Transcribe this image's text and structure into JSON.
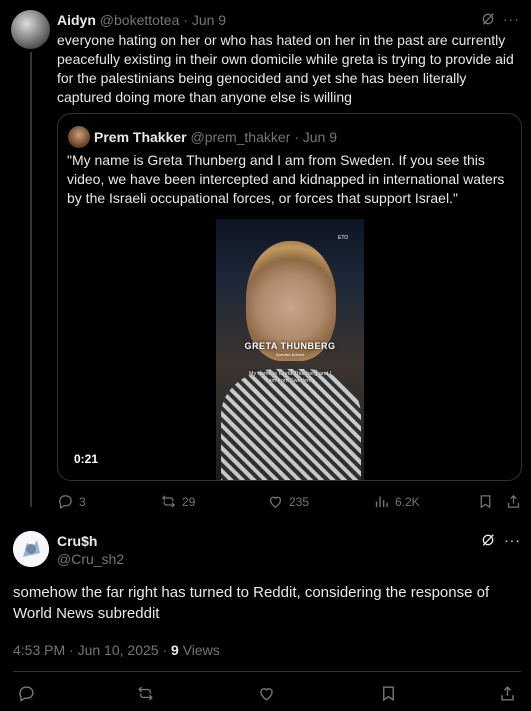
{
  "parent_tweet": {
    "display_name": "Aidyn",
    "handle": "@bokettotea",
    "separator": "·",
    "date": "Jun 9",
    "text": "everyone hating on her or who has hated on her in the past are currently peacefully existing in their own domicile while greta is trying to provide aid for the palestinians being genocided and yet she has been literally captured doing more than anyone else is willing",
    "more_label": "···",
    "quoted": {
      "display_name": "Prem Thakker",
      "handle": "@prem_thakker",
      "separator": "·",
      "date": "Jun 9",
      "text": "\"My name is Greta Thunberg and I am from Sweden. If you see this video, we have been intercepted and kidnapped in international waters by the Israeli occupational forces, or forces that support Israel.\"",
      "video": {
        "overlay_title": "GRETA THUNBERG",
        "overlay_subtitle": "Swedish Activist",
        "caption": "My name is Greta Thunberg and I am from Sweden.",
        "badge": "ETO",
        "duration": "0:21"
      }
    },
    "actions": {
      "replies": "3",
      "reposts": "29",
      "likes": "235",
      "views": "6.2K"
    }
  },
  "reply_tweet": {
    "display_name": "Cru$h",
    "handle": "@Cru_sh2",
    "text": "somehow the far right has turned to Reddit, considering the response of World News subreddit",
    "time": "4:53 PM",
    "separator": "·",
    "date": "Jun 10, 2025",
    "views_count": "9",
    "views_label": "Views",
    "more_label": "···"
  },
  "colors": {
    "background": "#000000",
    "text": "#e7e9ea",
    "muted": "#71767b",
    "border": "#2f3336"
  }
}
